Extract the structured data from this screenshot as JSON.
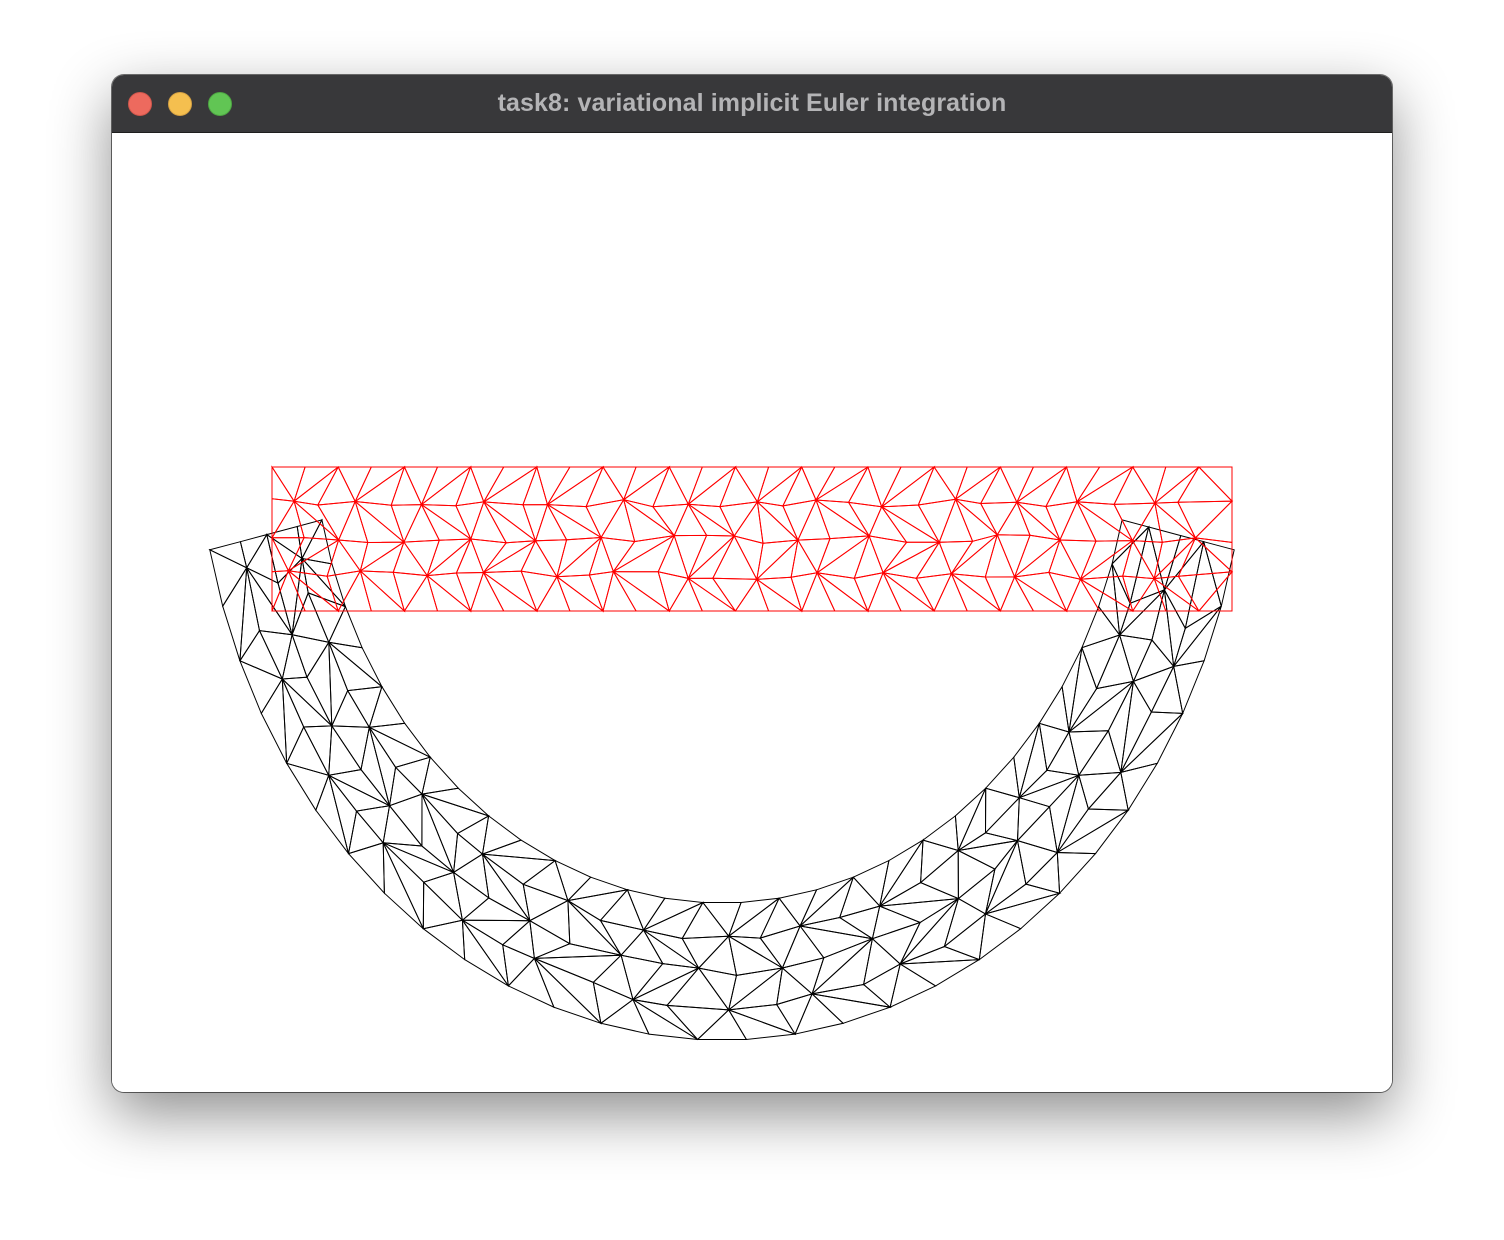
{
  "window": {
    "title": "task8: variational implicit Euler integration",
    "buttons": {
      "close": "close-button",
      "minimize": "minimize-button",
      "zoom": "zoom-button"
    }
  },
  "colors": {
    "titlebar": "#38383a",
    "title_text": "#b4b4b6",
    "close": "#ed6a5e",
    "minimize": "#f5bf4f",
    "zoom": "#61c554",
    "rest_mesh": "#ff0000",
    "deformed_mesh": "#000000",
    "background": "#ffffff"
  },
  "scene": {
    "rest_mesh_label": "rest-configuration-mesh",
    "deformed_mesh_label": "deformed-mesh"
  }
}
